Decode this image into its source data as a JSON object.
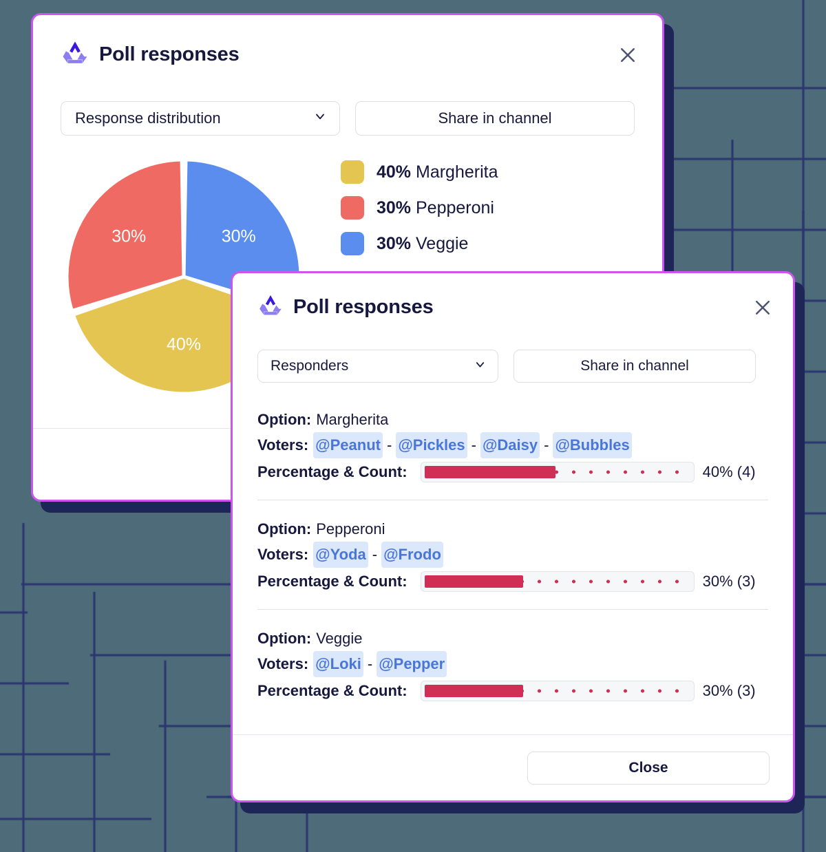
{
  "background": {
    "field_color": "#4d6b78",
    "grid_line_color": "#2b3570"
  },
  "chart_dialog": {
    "title": "Poll responses",
    "logo_icon": "recycle-triangle-logo",
    "close_icon": "close-x-icon",
    "border_color": "#cc55ee",
    "shadow_color": "#1d2657",
    "view_select": {
      "value": "Response distribution",
      "chevron_icon": "chevron-down-icon"
    },
    "share_button": "Share in channel"
  },
  "chart_data": {
    "type": "pie",
    "title": "Response distribution",
    "legend_position": "right",
    "start_angle_deg": 0,
    "gap_deg": 2,
    "categories": [
      "Margherita",
      "Pepperoni",
      "Veggie"
    ],
    "values": [
      40,
      30,
      30
    ],
    "value_suffix": "%",
    "colors": [
      "#e4c551",
      "#ef6a62",
      "#5b8def"
    ],
    "slices": [
      {
        "label": "Veggie",
        "value": 30,
        "display": "30%",
        "color": "#5b8def",
        "start": 0,
        "end": 108
      },
      {
        "label": "Margherita",
        "value": 40,
        "display": "40%",
        "color": "#e4c551",
        "start": 108,
        "end": 252
      },
      {
        "label": "Pepperoni",
        "value": 30,
        "display": "30%",
        "color": "#ef6a62",
        "start": 252,
        "end": 360
      }
    ],
    "legend": [
      {
        "percent": "40%",
        "label": "Margherita",
        "color": "#e4c551"
      },
      {
        "percent": "30%",
        "label": "Pepperoni",
        "color": "#ef6a62"
      },
      {
        "percent": "30%",
        "label": "Veggie",
        "color": "#5b8def"
      }
    ]
  },
  "responders_dialog": {
    "title": "Poll responses",
    "logo_icon": "recycle-triangle-logo",
    "close_icon": "close-x-icon",
    "view_select": {
      "value": "Responders",
      "chevron_icon": "chevron-down-icon"
    },
    "share_button": "Share in channel",
    "labels": {
      "option": "Option:",
      "voters": "Voters:",
      "percentage_count": "Percentage & Count:",
      "separator": "-"
    },
    "bar_color": "#cf2f54",
    "rows": [
      {
        "option": "Margherita",
        "voters": [
          "@Peanut",
          "@Pickles",
          "@Daisy",
          "@Bubbles"
        ],
        "percent": 40,
        "count": 4,
        "summary": "40% (4)"
      },
      {
        "option": "Pepperoni",
        "voters": [
          "@Yoda",
          "@Frodo"
        ],
        "percent": 30,
        "count": 3,
        "summary": "30% (3)"
      },
      {
        "option": "Veggie",
        "voters": [
          "@Loki",
          "@Pepper"
        ],
        "percent": 30,
        "count": 3,
        "summary": "30% (3)"
      }
    ],
    "close_button": "Close"
  }
}
